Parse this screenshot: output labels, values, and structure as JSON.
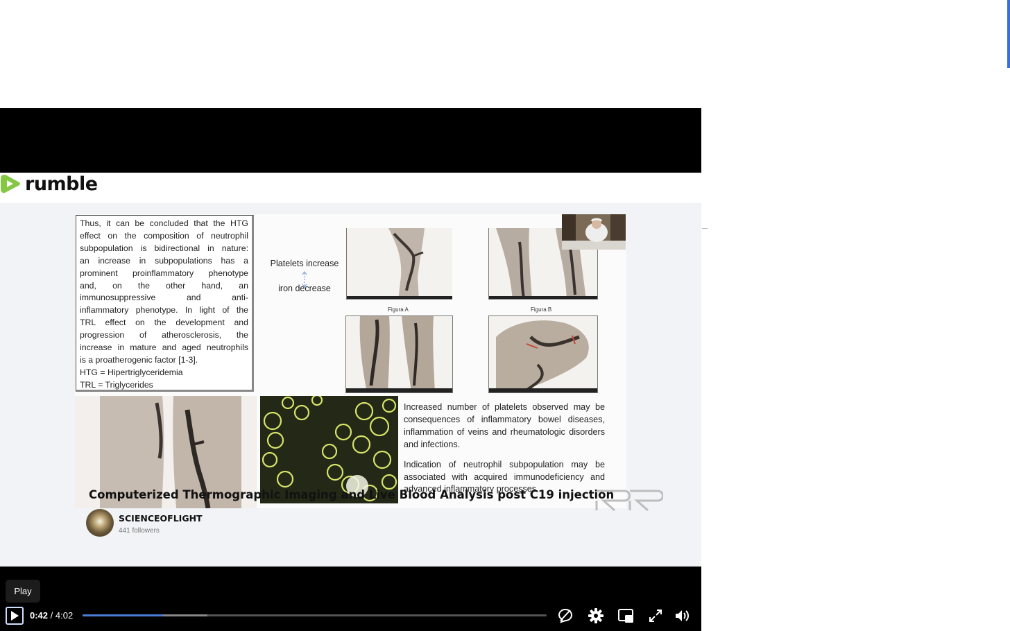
{
  "brand": {
    "name": "rumble",
    "accent": "#85c742"
  },
  "slide": {
    "left_text_lines": [
      "Thus, it can be concluded that the HTG",
      "effect on the composition of neutrophil",
      "subpopulation is bidirectional in nature:",
      "an increase in subpopulations has a",
      "prominent proinflammatory phenotype",
      "and, on the other hand, an",
      "immunosuppressive and anti-",
      "inflammatory phenotype. In light of the",
      "TRL effect on the development and",
      "progression of atherosclerosis, the",
      "increase in mature and aged neutrophils"
    ],
    "left_text_last": "is a proatherogenic factor [1-3].",
    "htg_def": "HTG = Hipertriglyceridemia",
    "trl_def": "TRL = Triglycerides",
    "platelets_label": "Platelets increase",
    "iron_label": "iron decrease",
    "figure_a": "Figura A",
    "figure_b": "Figura B",
    "right_para_1": "Increased number of platelets observed may be consequences of inflammatory bowel diseases, inflammation of veins and rheumatologic disorders and infections.",
    "right_para_2": "Indication of neutrophil subpopulation may be associated with acquired immunodeficiency and advanced inflammatory processes."
  },
  "video": {
    "title": "Computerized Thermographic Imaging and Live Blood Analysis post C19 injection",
    "channel_name": "SCIENCEOFLIGHT",
    "followers": "441 followers"
  },
  "controls": {
    "tooltip": "Play",
    "current_time": "0:42",
    "separator": " / ",
    "duration": "4:02",
    "progress_fraction": 0.174,
    "buffered_fraction": 0.269,
    "progress_color": "#4a7fd8"
  },
  "icons": [
    "play-icon",
    "chat-icon",
    "settings-icon",
    "pip-icon",
    "fullscreen-icon",
    "volume-icon"
  ]
}
